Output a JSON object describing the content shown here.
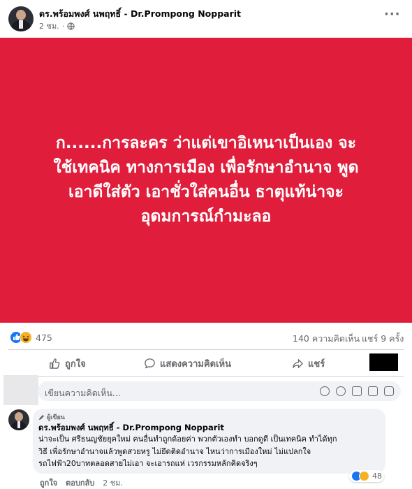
{
  "post": {
    "author": "ดร.พร้อมพงศ์ นพฤทธิ์ - Dr.Prompong Nopparit",
    "time": "2 ชม.",
    "privacy_icon": "globe-icon",
    "menu_icon": "more-dots-icon",
    "banner_text": "ก......การละคร ว่าแต่เขาอิเหนาเป็นเอง จะใช้เทคนิค ทางการเมือง เพื่อรักษาอำนาจ พูดเอาดีใส่ตัว เอาชั่วใส่คนอื่น ธาตุแท้น่าจะอุดมการณ์กำมะลอ",
    "banner_color": "#e01e3c"
  },
  "stats": {
    "reaction_count": "475",
    "comments": "140 ความคิดเห็น",
    "shares": "แชร์ 9 ครั้ง"
  },
  "actions": {
    "like": "ถูกใจ",
    "comment": "แสดงความคิดเห็น",
    "share": "แชร์"
  },
  "comment_box": {
    "placeholder": "เขียนความคิดเห็น..."
  },
  "comment": {
    "badge": "ผู้เขียน",
    "author": "ดร.พร้อมพงศ์ นพฤทธิ์ - Dr.Prompong Nopparit",
    "lines": [
      "น่าจะเป็น ศรีธนญชัยยุคใหม่ คนอื่นทำถูกด้อยค่า พวกตัวเองทำ บอกดูดี เป็นเทคนิค ทำได้ทุก",
      "วิธี เพื่อรักษาอำนาจแล้วพูดสวยหรู ไม่ยึดติดอำนาจ ไหนว่าการเมืองใหม่ ไม่แปลกใจ",
      "รถไฟฟ้า20บาทตลอดสายไม่เอา จะเอารถแห่ เวรกรรมหลักคิดจริงๆ"
    ],
    "like": "ถูกใจ",
    "reply": "ตอบกลับ",
    "time": "2 ชม.",
    "reaction_count": "48"
  }
}
